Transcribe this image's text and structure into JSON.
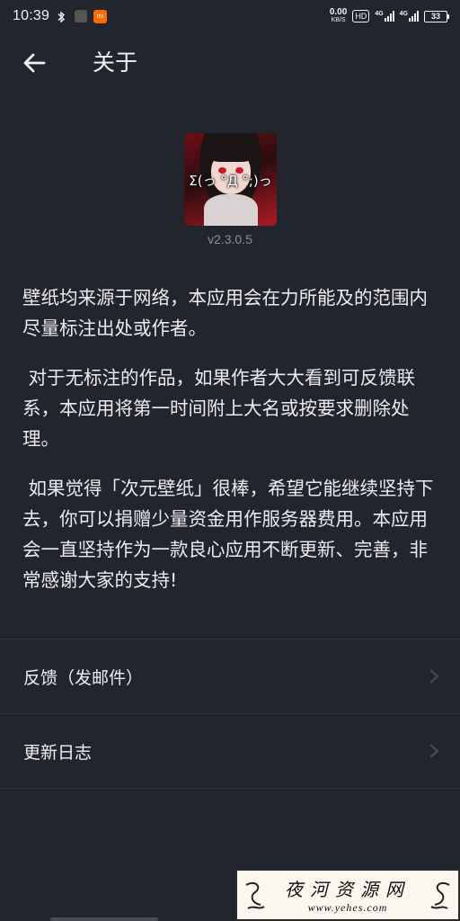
{
  "status_bar": {
    "time": "10:39",
    "speed_value": "0.00",
    "speed_unit": "KB/S",
    "hd": "HD",
    "net1": "4G",
    "net2": "4G",
    "battery": "33"
  },
  "toolbar": {
    "title": "关于"
  },
  "app": {
    "icon_text": "Σ(っ °Д °;)っ",
    "version": "v2.3.0.5"
  },
  "about": {
    "paragraphs": [
      "壁纸均来源于网络，本应用会在力所能及的范围内尽量标注出处或作者。",
      " 对于无标注的作品，如果作者大大看到可反馈联系，本应用将第一时间附上大名或按要求删除处理。",
      " 如果觉得「次元壁纸」很棒，希望它能继续坚持下去，你可以捐赠少量资金用作服务器费用。本应用会一直坚持作为一款良心应用不断更新、完善，非常感谢大家的支持!"
    ]
  },
  "menu": {
    "feedback_label": "反馈（发邮件）",
    "changelog_label": "更新日志"
  },
  "watermark": {
    "title": "夜河资源网",
    "url": "www.yehes.com"
  },
  "colors": {
    "background": "#23252e",
    "text": "#ececef",
    "muted": "#8c8e97",
    "divider": "#33353f"
  }
}
